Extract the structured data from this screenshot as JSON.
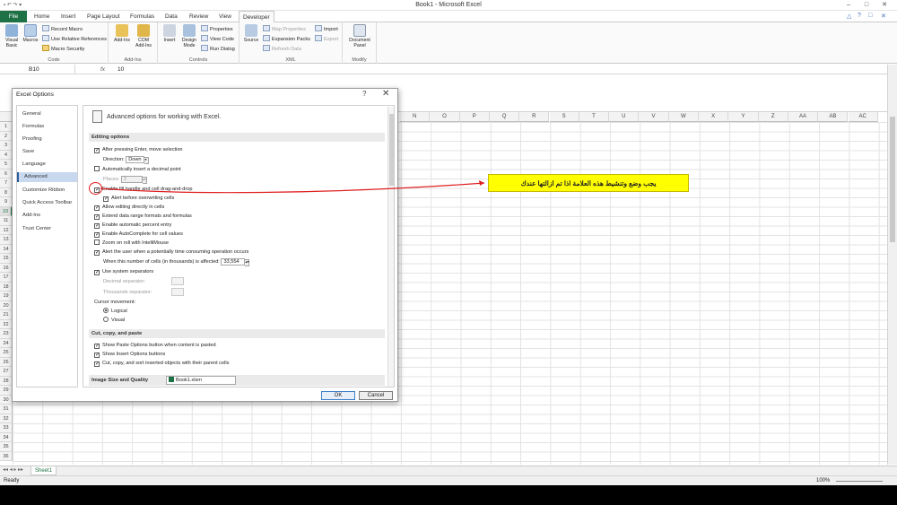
{
  "window": {
    "title": "Book1 - Microsoft Excel",
    "min": "–",
    "max": "□",
    "close": "✕"
  },
  "ribbon_tabs": [
    "File",
    "Home",
    "Insert",
    "Page Layout",
    "Formulas",
    "Data",
    "Review",
    "View",
    "Developer"
  ],
  "ribbon_groups": {
    "code": {
      "label": "Code",
      "visual_basic": "Visual Basic",
      "macros": "Macros",
      "record_macro": "Record Macro",
      "relative_refs": "Use Relative References",
      "macro_security": "Macro Security"
    },
    "addins": {
      "label": "Add-Ins",
      "addins": "Add-Ins",
      "com_addins": "COM Add-Ins"
    },
    "controls": {
      "label": "Controls",
      "insert": "Insert",
      "design_mode": "Design Mode",
      "properties": "Properties",
      "view_code": "View Code",
      "run_dialog": "Run Dialog"
    },
    "xml": {
      "label": "XML",
      "source": "Source",
      "map_properties": "Map Properties",
      "expansion_packs": "Expansion Packs",
      "refresh_data": "Refresh Data",
      "import": "Import",
      "export": "Export"
    },
    "modify": {
      "label": "Modify",
      "document_panel": "Document Panel"
    }
  },
  "formula_bar": {
    "name_box": "B10",
    "fx": "fx",
    "value": "10"
  },
  "columns": [
    "N",
    "O",
    "P",
    "Q",
    "R",
    "S",
    "T",
    "U",
    "V",
    "W",
    "X",
    "Y",
    "Z",
    "AA",
    "AB",
    "AC"
  ],
  "rows": [
    "1",
    "2",
    "3",
    "4",
    "5",
    "6",
    "7",
    "8",
    "9",
    "10",
    "11",
    "12",
    "13",
    "14",
    "15",
    "16",
    "17",
    "18",
    "19",
    "20",
    "21",
    "22",
    "23",
    "24",
    "25",
    "26",
    "27",
    "28",
    "29",
    "30",
    "31",
    "32",
    "33",
    "34",
    "35",
    "36"
  ],
  "selected_row": "10",
  "sheet_tab": "Sheet1",
  "status": {
    "left": "Ready",
    "zoom": "100%"
  },
  "dialog": {
    "title": "Excel Options",
    "help": "?",
    "close": "✕",
    "nav": [
      "General",
      "Formulas",
      "Proofing",
      "Save",
      "Language",
      "Advanced",
      "Customize Ribbon",
      "Quick Access Toolbar",
      "Add-Ins",
      "Trust Center"
    ],
    "active_nav": "Advanced",
    "header": "Advanced options for working with Excel.",
    "sections": {
      "editing": "Editing options",
      "cut_copy": "Cut, copy, and paste",
      "image": "Image Size and Quality"
    },
    "options": {
      "after_enter": "After pressing Enter, move selection",
      "direction_label": "Direction:",
      "direction_value": "Down",
      "auto_decimal": "Automatically insert a decimal point",
      "places_label": "Places:",
      "places_value": "2",
      "fill_handle": "Enable fill handle and cell drag-and-drop",
      "alert_overwrite": "Alert before overwriting cells",
      "edit_in_cells": "Allow editing directly in cells",
      "extend_formats": "Extend data range formats and formulas",
      "auto_percent": "Enable automatic percent entry",
      "autocomplete": "Enable AutoComplete for cell values",
      "zoom_roll": "Zoom on roll with IntelliMouse",
      "alert_time": "Alert the user when a potentially time consuming operation occurs",
      "cells_affected_label": "When this number of cells (in thousands) is affected:",
      "cells_affected_value": "33,554",
      "system_separators": "Use system separators",
      "decimal_sep": "Decimal separator:",
      "thousands_sep": "Thousands separator:",
      "cursor_movement": "Cursor movement:",
      "logical": "Logical",
      "visual": "Visual",
      "paste_options": "Show Paste Options button when content is pasted",
      "insert_options": "Show Insert Options buttons",
      "cut_copy_sort": "Cut, copy, and sort inserted objects with their parent cells",
      "image_file": "Book1.xlsm"
    },
    "ok": "OK",
    "cancel": "Cancel"
  },
  "annotation": {
    "text": "يجب وضع وتنشيط هذه العلامة اذا تم ازالتها عندك",
    "color": "#ffff00",
    "arrow_color": "#e02020"
  },
  "colors": {
    "excel_green": "#1e7145",
    "nav_active": "#c8d9ef"
  }
}
